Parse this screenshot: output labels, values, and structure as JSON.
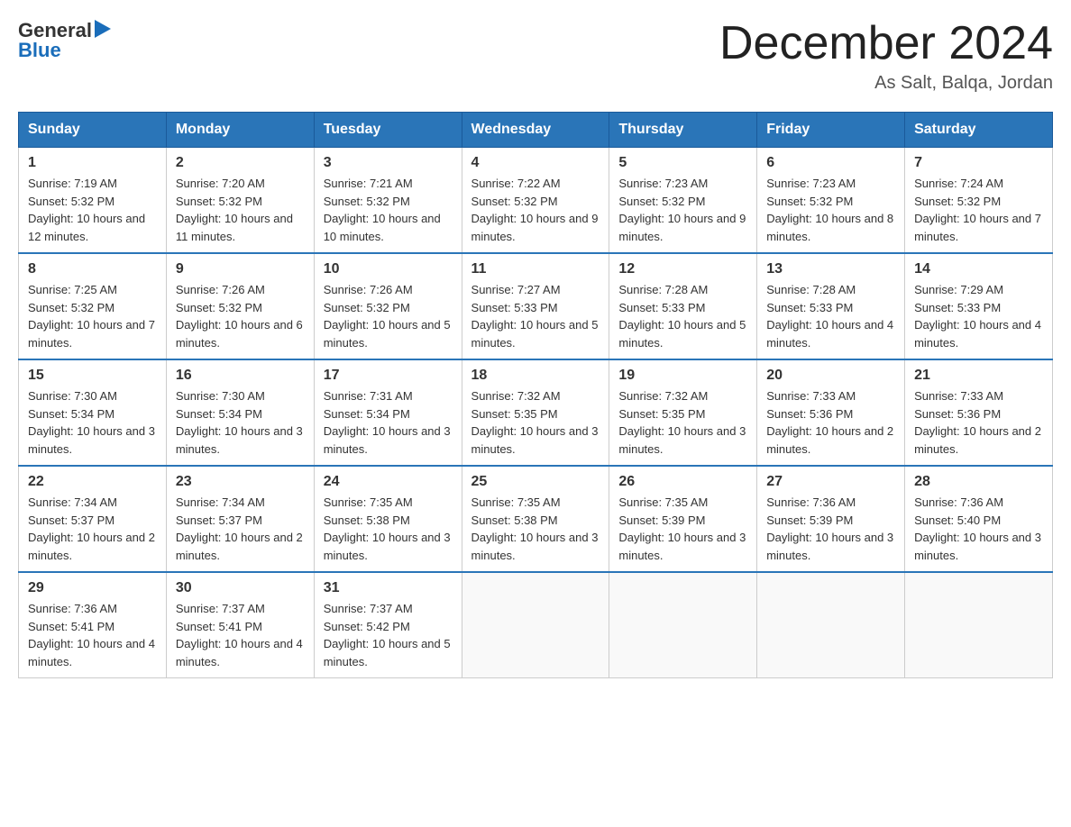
{
  "logo": {
    "text_general": "General",
    "text_blue": "Blue",
    "arrow": "▶"
  },
  "title": "December 2024",
  "location": "As Salt, Balqa, Jordan",
  "days_of_week": [
    "Sunday",
    "Monday",
    "Tuesday",
    "Wednesday",
    "Thursday",
    "Friday",
    "Saturday"
  ],
  "weeks": [
    [
      {
        "day": "1",
        "sunrise": "7:19 AM",
        "sunset": "5:32 PM",
        "daylight": "10 hours and 12 minutes."
      },
      {
        "day": "2",
        "sunrise": "7:20 AM",
        "sunset": "5:32 PM",
        "daylight": "10 hours and 11 minutes."
      },
      {
        "day": "3",
        "sunrise": "7:21 AM",
        "sunset": "5:32 PM",
        "daylight": "10 hours and 10 minutes."
      },
      {
        "day": "4",
        "sunrise": "7:22 AM",
        "sunset": "5:32 PM",
        "daylight": "10 hours and 9 minutes."
      },
      {
        "day": "5",
        "sunrise": "7:23 AM",
        "sunset": "5:32 PM",
        "daylight": "10 hours and 9 minutes."
      },
      {
        "day": "6",
        "sunrise": "7:23 AM",
        "sunset": "5:32 PM",
        "daylight": "10 hours and 8 minutes."
      },
      {
        "day": "7",
        "sunrise": "7:24 AM",
        "sunset": "5:32 PM",
        "daylight": "10 hours and 7 minutes."
      }
    ],
    [
      {
        "day": "8",
        "sunrise": "7:25 AM",
        "sunset": "5:32 PM",
        "daylight": "10 hours and 7 minutes."
      },
      {
        "day": "9",
        "sunrise": "7:26 AM",
        "sunset": "5:32 PM",
        "daylight": "10 hours and 6 minutes."
      },
      {
        "day": "10",
        "sunrise": "7:26 AM",
        "sunset": "5:32 PM",
        "daylight": "10 hours and 5 minutes."
      },
      {
        "day": "11",
        "sunrise": "7:27 AM",
        "sunset": "5:33 PM",
        "daylight": "10 hours and 5 minutes."
      },
      {
        "day": "12",
        "sunrise": "7:28 AM",
        "sunset": "5:33 PM",
        "daylight": "10 hours and 5 minutes."
      },
      {
        "day": "13",
        "sunrise": "7:28 AM",
        "sunset": "5:33 PM",
        "daylight": "10 hours and 4 minutes."
      },
      {
        "day": "14",
        "sunrise": "7:29 AM",
        "sunset": "5:33 PM",
        "daylight": "10 hours and 4 minutes."
      }
    ],
    [
      {
        "day": "15",
        "sunrise": "7:30 AM",
        "sunset": "5:34 PM",
        "daylight": "10 hours and 3 minutes."
      },
      {
        "day": "16",
        "sunrise": "7:30 AM",
        "sunset": "5:34 PM",
        "daylight": "10 hours and 3 minutes."
      },
      {
        "day": "17",
        "sunrise": "7:31 AM",
        "sunset": "5:34 PM",
        "daylight": "10 hours and 3 minutes."
      },
      {
        "day": "18",
        "sunrise": "7:32 AM",
        "sunset": "5:35 PM",
        "daylight": "10 hours and 3 minutes."
      },
      {
        "day": "19",
        "sunrise": "7:32 AM",
        "sunset": "5:35 PM",
        "daylight": "10 hours and 3 minutes."
      },
      {
        "day": "20",
        "sunrise": "7:33 AM",
        "sunset": "5:36 PM",
        "daylight": "10 hours and 2 minutes."
      },
      {
        "day": "21",
        "sunrise": "7:33 AM",
        "sunset": "5:36 PM",
        "daylight": "10 hours and 2 minutes."
      }
    ],
    [
      {
        "day": "22",
        "sunrise": "7:34 AM",
        "sunset": "5:37 PM",
        "daylight": "10 hours and 2 minutes."
      },
      {
        "day": "23",
        "sunrise": "7:34 AM",
        "sunset": "5:37 PM",
        "daylight": "10 hours and 2 minutes."
      },
      {
        "day": "24",
        "sunrise": "7:35 AM",
        "sunset": "5:38 PM",
        "daylight": "10 hours and 3 minutes."
      },
      {
        "day": "25",
        "sunrise": "7:35 AM",
        "sunset": "5:38 PM",
        "daylight": "10 hours and 3 minutes."
      },
      {
        "day": "26",
        "sunrise": "7:35 AM",
        "sunset": "5:39 PM",
        "daylight": "10 hours and 3 minutes."
      },
      {
        "day": "27",
        "sunrise": "7:36 AM",
        "sunset": "5:39 PM",
        "daylight": "10 hours and 3 minutes."
      },
      {
        "day": "28",
        "sunrise": "7:36 AM",
        "sunset": "5:40 PM",
        "daylight": "10 hours and 3 minutes."
      }
    ],
    [
      {
        "day": "29",
        "sunrise": "7:36 AM",
        "sunset": "5:41 PM",
        "daylight": "10 hours and 4 minutes."
      },
      {
        "day": "30",
        "sunrise": "7:37 AM",
        "sunset": "5:41 PM",
        "daylight": "10 hours and 4 minutes."
      },
      {
        "day": "31",
        "sunrise": "7:37 AM",
        "sunset": "5:42 PM",
        "daylight": "10 hours and 5 minutes."
      },
      null,
      null,
      null,
      null
    ]
  ]
}
